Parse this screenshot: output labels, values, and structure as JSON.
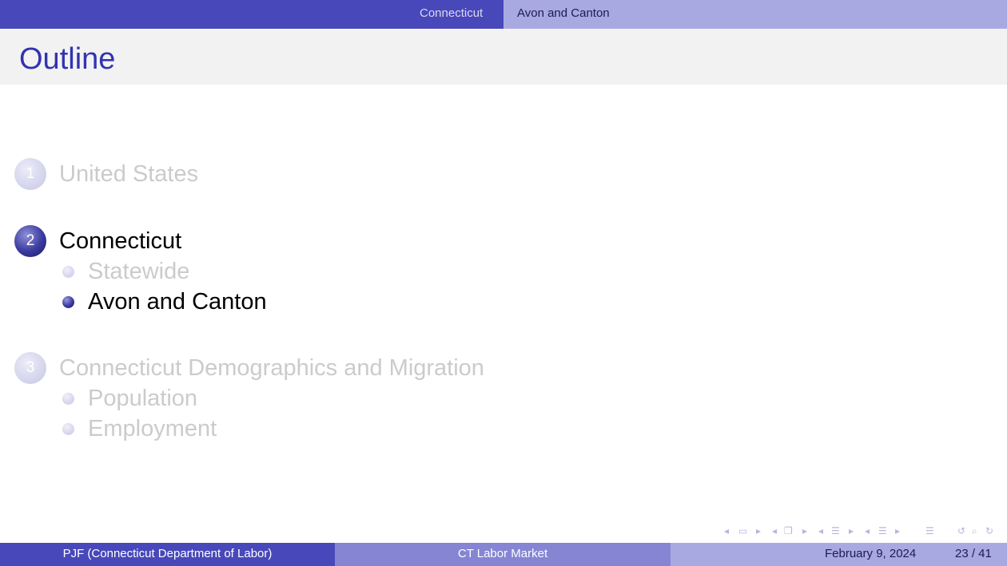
{
  "header": {
    "current_section": "Connecticut",
    "current_subsection": "Avon and Canton"
  },
  "frame": {
    "title": "Outline"
  },
  "outline": {
    "sections": [
      {
        "number": "1",
        "label": "United States"
      },
      {
        "number": "2",
        "label": "Connecticut",
        "subsections": [
          "Statewide",
          "Avon and Canton"
        ]
      },
      {
        "number": "3",
        "label": "Connecticut Demographics and Migration",
        "subsections": [
          "Population",
          "Employment"
        ]
      }
    ],
    "active_section": "2",
    "active_subsection": "Avon and Canton"
  },
  "footer": {
    "author": "PJF (Connecticut Department of Labor)",
    "short_title": "CT Labor Market",
    "date": "February 9, 2024",
    "page_label": "23 / 41"
  },
  "colors": {
    "theme_dark": "#4848ba",
    "theme_mid": "#8585d4",
    "theme_light": "#a9a9e2",
    "title_text": "#3333b2",
    "faded_text": "#cbcbcb"
  },
  "icons": [
    "triangle-left-icon",
    "frame-icon",
    "triangle-right-icon",
    "subsection-icon",
    "section-icon",
    "appendix-icon",
    "undo-icon",
    "search-icon",
    "redo-icon"
  ]
}
